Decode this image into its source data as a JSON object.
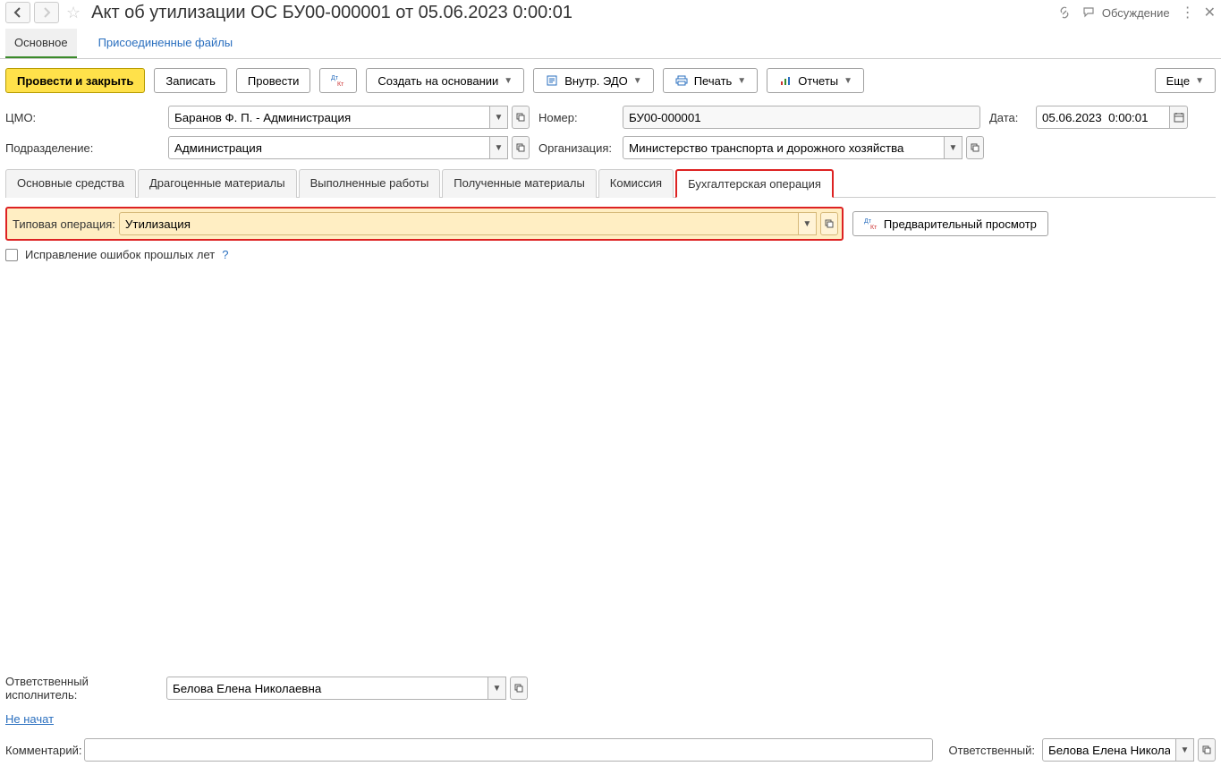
{
  "title": "Акт об утилизации ОС БУ00-000001 от 05.06.2023 0:00:01",
  "discussion_label": "Обсуждение",
  "navtabs": {
    "main": "Основное",
    "files": "Присоединенные файлы"
  },
  "toolbar": {
    "post_close": "Провести и закрыть",
    "save": "Записать",
    "post": "Провести",
    "create_based": "Создать на основании",
    "edo": "Внутр. ЭДО",
    "print": "Печать",
    "reports": "Отчеты",
    "more": "Еще"
  },
  "labels": {
    "tmo": "ЦМО:",
    "podr": "Подразделение:",
    "nomer": "Номер:",
    "org": "Организация:",
    "data": "Дата:",
    "typical_op": "Типовая операция:",
    "preview": "Предварительный просмотр",
    "fix_errors": "Исправление ошибок прошлых лет",
    "resp_exec": "Ответственный исполнитель:",
    "not_started": "Не начат",
    "comment": "Комментарий:",
    "responsible": "Ответственный:"
  },
  "fields": {
    "tmo": "Баранов Ф. П. - Администрация",
    "podr": "Администрация",
    "nomer": "БУ00-000001",
    "org": "Министерство транспорта и дорожного хозяйства",
    "data": "05.06.2023  0:00:01",
    "typical_op": "Утилизация",
    "resp_exec": "Белова Елена Николаевна",
    "comment": "",
    "responsible": "Белова Елена Николаевн"
  },
  "subtabs": [
    "Основные средства",
    "Драгоценные материалы",
    "Выполненные работы",
    "Полученные материалы",
    "Комиссия",
    "Бухгалтерская операция"
  ],
  "active_subtab": 5
}
